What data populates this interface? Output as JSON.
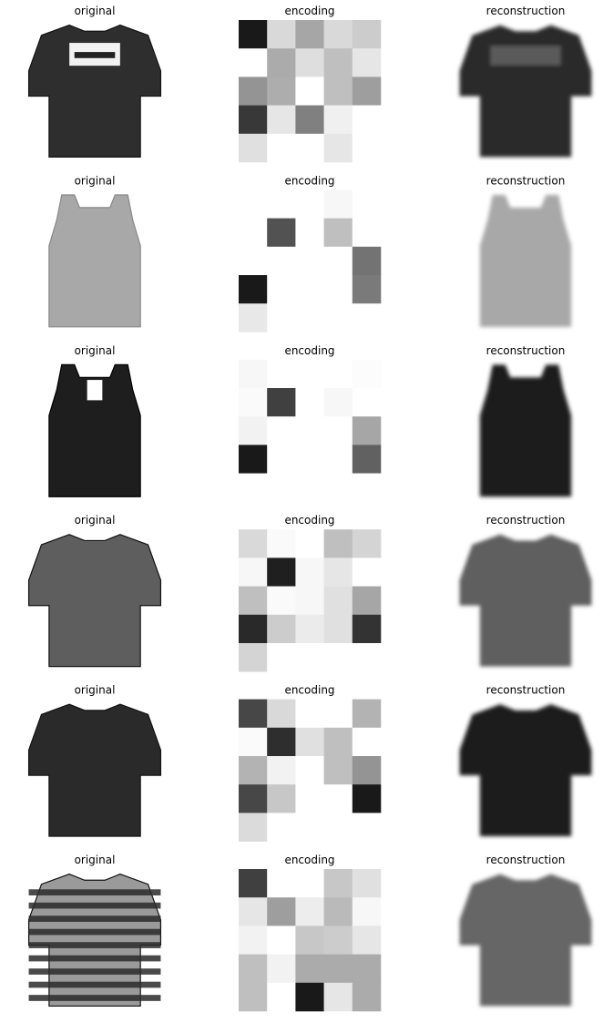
{
  "chart_data": {
    "type": "heatmap",
    "description_rows": 6,
    "colormap": "binary",
    "titles": [
      "original",
      "encoding",
      "reconstruction"
    ],
    "rows": [
      {
        "original_titles": "original",
        "encoding": [
          [
            0.9,
            0.15,
            0.35,
            0.15,
            0.2
          ],
          [
            0.0,
            0.33,
            0.13,
            0.25,
            0.1
          ],
          [
            0.42,
            0.32,
            0.0,
            0.25,
            0.38
          ],
          [
            0.78,
            0.1,
            0.5,
            0.06,
            0.0
          ],
          [
            0.12,
            0.0,
            0.0,
            0.1,
            0.0
          ]
        ],
        "original_kind": "tshirt-print",
        "reconstruction_kind": "tshirt-dark"
      },
      {
        "encoding": [
          [
            0.0,
            0.0,
            0.0,
            0.03,
            0.0
          ],
          [
            0.0,
            0.68,
            0.0,
            0.25,
            0.0
          ],
          [
            0.0,
            0.0,
            0.0,
            0.0,
            0.55
          ],
          [
            0.9,
            0.0,
            0.0,
            0.0,
            0.52
          ],
          [
            0.09,
            0.0,
            0.0,
            0.0,
            0.0
          ]
        ],
        "original_kind": "tank-light",
        "reconstruction_kind": "tank-light"
      },
      {
        "encoding": [
          [
            0.03,
            0.0,
            0.0,
            0.0,
            0.01
          ],
          [
            0.02,
            0.75,
            0.0,
            0.03,
            0.0
          ],
          [
            0.05,
            0.0,
            0.0,
            0.0,
            0.35
          ],
          [
            0.9,
            0.0,
            0.0,
            0.0,
            0.62
          ],
          [
            0.0,
            0.0,
            0.0,
            0.0,
            0.0
          ]
        ],
        "original_kind": "tank-dark",
        "reconstruction_kind": "tank-dark"
      },
      {
        "encoding": [
          [
            0.15,
            0.02,
            0.0,
            0.25,
            0.17
          ],
          [
            0.03,
            0.88,
            0.03,
            0.1,
            0.0
          ],
          [
            0.25,
            0.02,
            0.03,
            0.12,
            0.35
          ],
          [
            0.84,
            0.2,
            0.08,
            0.12,
            0.8
          ],
          [
            0.17,
            0.0,
            0.0,
            0.0,
            0.0
          ]
        ],
        "original_kind": "tshirt-mid",
        "reconstruction_kind": "tshirt-mid"
      },
      {
        "encoding": [
          [
            0.72,
            0.15,
            0.0,
            0.0,
            0.3
          ],
          [
            0.02,
            0.82,
            0.12,
            0.25,
            0.0
          ],
          [
            0.3,
            0.05,
            0.0,
            0.25,
            0.42
          ],
          [
            0.72,
            0.22,
            0.0,
            0.0,
            0.9
          ],
          [
            0.14,
            0.0,
            0.0,
            0.0,
            0.0
          ]
        ],
        "original_kind": "tshirt-dark",
        "reconstruction_kind": "tshirt-darker"
      },
      {
        "encoding": [
          [
            0.75,
            0.0,
            0.0,
            0.22,
            0.12
          ],
          [
            0.1,
            0.38,
            0.07,
            0.27,
            0.03
          ],
          [
            0.05,
            0.0,
            0.22,
            0.2,
            0.1
          ],
          [
            0.25,
            0.05,
            0.33,
            0.33,
            0.33
          ],
          [
            0.25,
            0.0,
            0.9,
            0.1,
            0.33
          ]
        ],
        "original_kind": "striped-tee",
        "reconstruction_kind": "tshirt-wide"
      }
    ]
  }
}
